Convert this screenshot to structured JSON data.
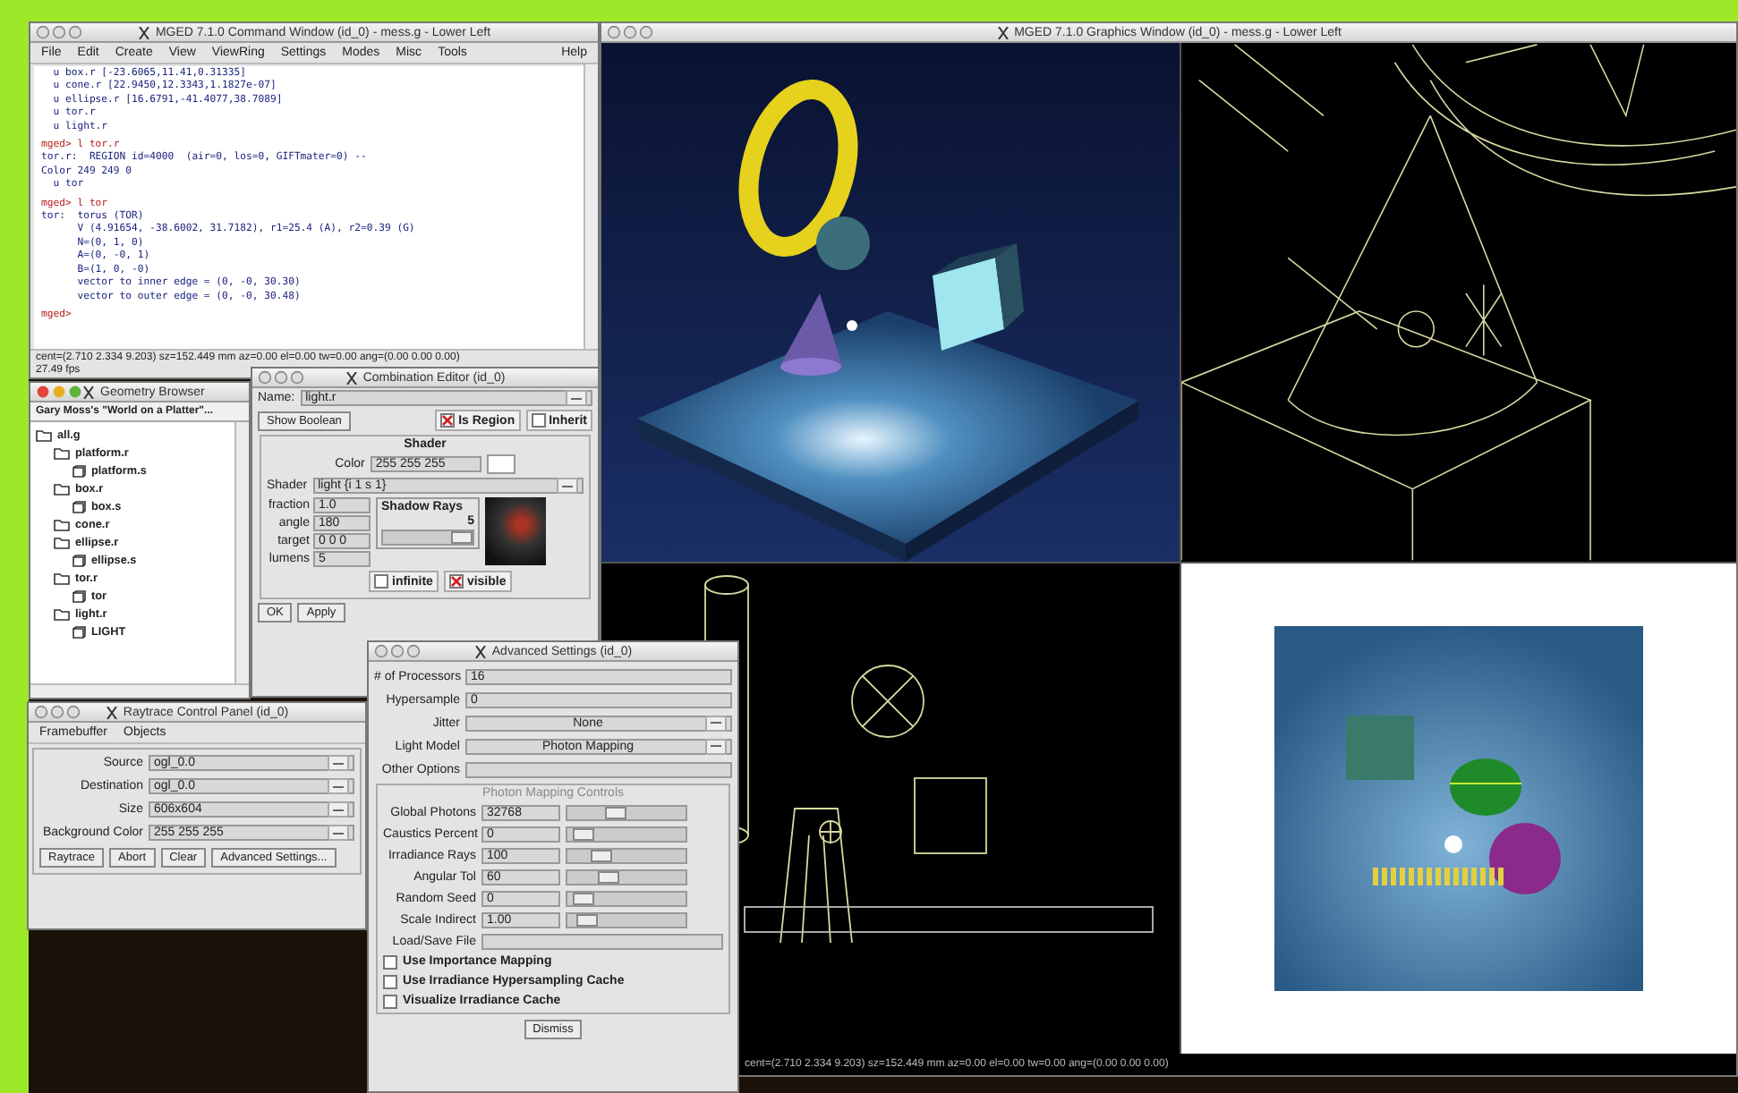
{
  "graphics_window": {
    "title": "MGED 7.1.0 Graphics Window (id_0) - mess.g - Lower Left",
    "status": "cent=(2.710 2.334 9.203) sz=152.449 mm az=0.00 el=0.00 tw=0.00 ang=(0.00 0.00 0.00)"
  },
  "command_window": {
    "title": "MGED 7.1.0 Command Window (id_0) - mess.g - Lower Left",
    "menu": [
      "File",
      "Edit",
      "Create",
      "View",
      "ViewRing",
      "Settings",
      "Modes",
      "Misc",
      "Tools"
    ],
    "help": "Help",
    "lines": [
      {
        "kind": "output",
        "text": "  u box.r [-23.6065,11.41,0.31335]"
      },
      {
        "kind": "output",
        "text": "  u cone.r [22.9450,12.3343,1.1827e-07]"
      },
      {
        "kind": "output",
        "text": "  u ellipse.r [16.6791,-41.4077,38.7089]"
      },
      {
        "kind": "output",
        "text": "  u tor.r"
      },
      {
        "kind": "output",
        "text": "  u light.r"
      },
      {
        "kind": "prompt",
        "text": "mged> l tor.r"
      },
      {
        "kind": "output",
        "text": "tor.r:  REGION id=4000  (air=0, los=0, GIFTmater=0) --"
      },
      {
        "kind": "output",
        "text": "Color 249 249 0"
      },
      {
        "kind": "output",
        "text": "  u tor"
      },
      {
        "kind": "prompt",
        "text": "mged> l tor"
      },
      {
        "kind": "output",
        "text": "tor:  torus (TOR)"
      },
      {
        "kind": "output",
        "text": "      V (4.91654, -38.6002, 31.7182), r1=25.4 (A), r2=0.39 (G)"
      },
      {
        "kind": "output",
        "text": "      N=(0, 1, 0)"
      },
      {
        "kind": "output",
        "text": "      A=(0, -0, 1)"
      },
      {
        "kind": "output",
        "text": "      B=(1, 0, -0)"
      },
      {
        "kind": "output",
        "text": "      vector to inner edge = (0, -0, 30.30)"
      },
      {
        "kind": "output",
        "text": "      vector to outer edge = (0, -0, 30.48)"
      },
      {
        "kind": "prompt",
        "text": "mged>"
      }
    ],
    "status": "cent=(2.710 2.334 9.203) sz=152.449 mm az=0.00 el=0.00 tw=0.00 ang=(0.00 0.00 0.00)",
    "fps": "27.49 fps"
  },
  "geometry_browser": {
    "title": "Geometry Browser",
    "header": "Gary Moss's \"World on a Platter\"...",
    "tree": [
      {
        "label": "all.g",
        "kind": "folder",
        "children": [
          {
            "label": "platform.r",
            "kind": "folder",
            "children": [
              {
                "label": "platform.s",
                "kind": "leaf"
              }
            ]
          },
          {
            "label": "box.r",
            "kind": "folder",
            "children": [
              {
                "label": "box.s",
                "kind": "leaf"
              }
            ]
          },
          {
            "label": "cone.r",
            "kind": "folder"
          },
          {
            "label": "ellipse.r",
            "kind": "folder",
            "children": [
              {
                "label": "ellipse.s",
                "kind": "leaf"
              }
            ]
          },
          {
            "label": "tor.r",
            "kind": "folder",
            "children": [
              {
                "label": "tor",
                "kind": "leaf"
              }
            ]
          },
          {
            "label": "light.r",
            "kind": "folder",
            "children": [
              {
                "label": "LIGHT",
                "kind": "leaf"
              }
            ]
          }
        ]
      }
    ]
  },
  "combination_editor": {
    "title": "Combination Editor (id_0)",
    "name_label": "Name:",
    "name": "light.r",
    "show_boolean": "Show Boolean",
    "flags": [
      {
        "label": "Is Region",
        "checked": true
      },
      {
        "label": "Inherit",
        "checked": false
      }
    ],
    "shader_title": "Shader",
    "color_label": "Color",
    "color_value": "255 255 255",
    "shader_label": "Shader",
    "shader": "light {i 1 s 1}",
    "params": [
      {
        "label": "fraction",
        "value": "1.0"
      },
      {
        "label": "angle",
        "value": "180"
      },
      {
        "label": "target",
        "value": "0 0 0"
      },
      {
        "label": "lumens",
        "value": "5"
      }
    ],
    "shadow_rays": {
      "label": "Shadow Rays",
      "value": "5",
      "level": 0.9
    },
    "options": [
      {
        "label": "infinite",
        "checked": false
      },
      {
        "label": "visible",
        "checked": true
      }
    ],
    "buttons": [
      "OK",
      "Apply"
    ]
  },
  "raytrace_panel": {
    "title": "Raytrace Control Panel (id_0)",
    "menu": [
      "Framebuffer",
      "Objects"
    ],
    "fields": [
      {
        "label": "Source",
        "value": "ogl_0.0"
      },
      {
        "label": "Destination",
        "value": "ogl_0.0"
      },
      {
        "label": "Size",
        "value": "606x604"
      },
      {
        "label": "Background Color",
        "value": "255 255 255"
      }
    ],
    "buttons": [
      "Raytrace",
      "Abort",
      "Clear",
      "Advanced Settings..."
    ]
  },
  "advanced_settings": {
    "title": "Advanced Settings (id_0)",
    "fields": [
      {
        "label": "# of Processors",
        "value": "16",
        "kind": "entry"
      },
      {
        "label": "Hypersample",
        "value": "0",
        "kind": "entry"
      },
      {
        "label": "Jitter",
        "value": "None",
        "kind": "menu"
      },
      {
        "label": "Light Model",
        "value": "Photon Mapping",
        "kind": "menu"
      },
      {
        "label": "Other Options",
        "kind": "entry"
      }
    ],
    "group_title": "Photon Mapping Controls",
    "sliders": [
      {
        "label": "Global Photons",
        "value": "32768",
        "level": 0.4
      },
      {
        "label": "Caustics Percent",
        "value": "0",
        "level": 0.05
      },
      {
        "label": "Irradiance Rays",
        "value": "100",
        "level": 0.25
      },
      {
        "label": "Angular Tol",
        "value": "60",
        "level": 0.32
      },
      {
        "label": "Random Seed",
        "value": "0",
        "level": 0.05
      },
      {
        "label": "Scale Indirect",
        "value": "1.00",
        "level": 0.1
      }
    ],
    "file_label": "Load/Save File",
    "checks": [
      {
        "label": "Use Importance Mapping",
        "checked": false
      },
      {
        "label": "Use Irradiance Hypersampling Cache",
        "checked": false
      },
      {
        "label": "Visualize Irradiance Cache",
        "checked": false
      }
    ],
    "dismiss": "Dismiss"
  }
}
